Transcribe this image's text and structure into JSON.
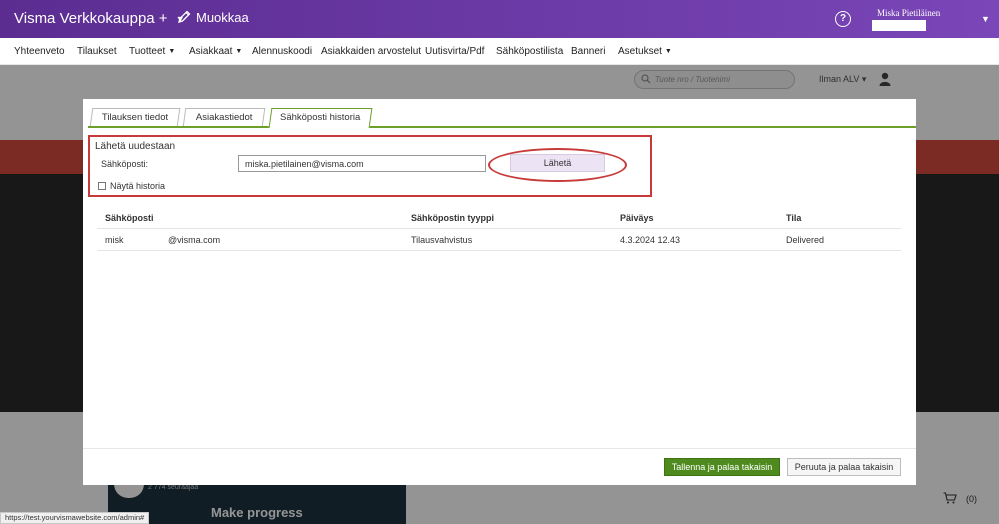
{
  "header": {
    "brand": "Visma Verkkokauppa +",
    "edit_label": "Muokkaa",
    "help_glyph": "?",
    "user_name": "Miska Pietiläinen",
    "caret": "▼"
  },
  "nav": {
    "items": [
      "Yhteenveto",
      "Tilaukset",
      "Tuotteet",
      "Asiakkaat",
      "Alennuskoodi",
      "Asiakkaiden arvostelut",
      "Uutisvirta/Pdf",
      "Sähköpostilista",
      "Banneri",
      "Asetukset"
    ],
    "caret": "▼"
  },
  "background": {
    "search_placeholder": "Tuote nro / Tuotenimi",
    "vat_label": "Ilman ALV",
    "vat_caret": "▾",
    "card_sub": "2 774 seuraajaa",
    "card_text": "Make progress",
    "cart_count": "(0)",
    "status_url": "https://test.yourvismawebsite.com/admin#"
  },
  "modal": {
    "tabs": [
      "Tilauksen tiedot",
      "Asiakastiedot",
      "Sähköposti historia"
    ],
    "active_tab": "Sähköposti historia",
    "resend": {
      "title": "Lähetä uudestaan",
      "email_label": "Sähköposti:",
      "email_value": "miska.pietilainen@visma.com",
      "send_label": "Lähetä",
      "history_label": "Näytä historia",
      "history_checked": false
    },
    "table": {
      "headers": [
        "Sähköposti",
        "Sähköpostin tyyppi",
        "Päiväys",
        "Tila"
      ],
      "rows": [
        {
          "email_prefix": "misk",
          "email_domain": "@visma.com",
          "type": "Tilausvahvistus",
          "date": "4.3.2024 12.43",
          "status": "Delivered"
        }
      ]
    },
    "footer": {
      "save_label": "Tallenna ja palaa takaisin",
      "cancel_label": "Peruuta ja palaa takaisin"
    }
  },
  "colors": {
    "topbar": "#6a3fa0",
    "highlight": "#c83a3a",
    "tab_accent": "#6ca02a",
    "save_button": "#4e8a1e"
  }
}
